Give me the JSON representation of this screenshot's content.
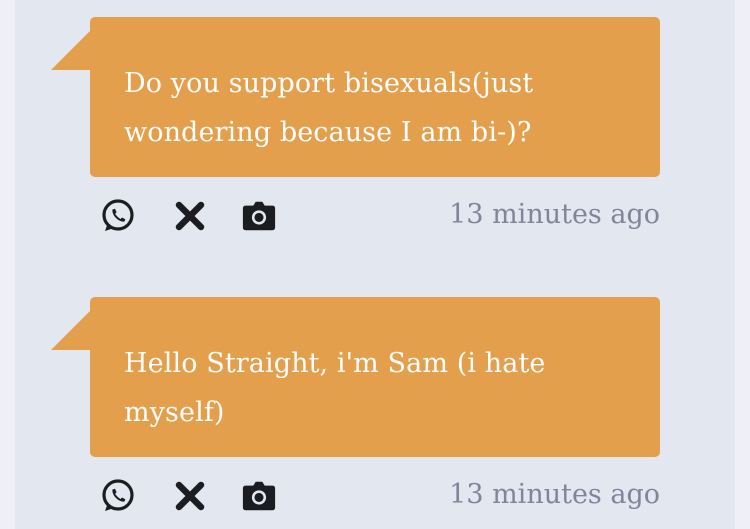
{
  "posts": [
    {
      "question": "Do you support bisexuals(just wondering because I am bi-)?",
      "time_ago": "13 minutes ago"
    },
    {
      "question": "Hello Straight, i'm Sam (i hate myself)",
      "time_ago": "13 minutes ago"
    }
  ],
  "share_icons": [
    "whatsapp-icon",
    "x-icon",
    "camera-icon"
  ],
  "colors": {
    "bubble": "#e49f4c",
    "feed_background": "#e3e7f0",
    "page_background": "#eef0f5",
    "timestamp": "#7f8699",
    "icon": "#1c1d21"
  }
}
